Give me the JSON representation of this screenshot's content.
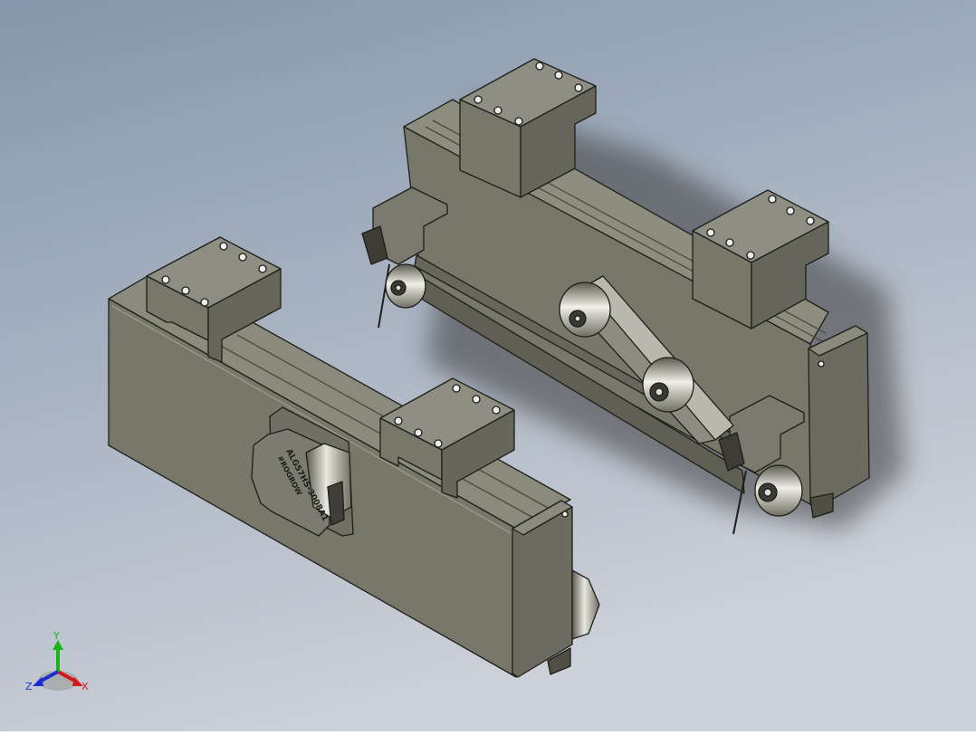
{
  "viewport": {
    "background_top": "#8a9bb0",
    "background_bottom": "#c9cdd6",
    "part_face_color": "#77776a",
    "part_top_color": "#8d8d80",
    "part_dark_color": "#55554b",
    "edge_color": "#1e1e1a"
  },
  "front_module": {
    "motor_label_line1": "ALG57HS-3008A1",
    "motor_label_line2": "#ROGROW"
  },
  "triad": {
    "x_label": "X",
    "y_label": "Y",
    "z_label": "Z",
    "x_color": "#d21a1a",
    "y_color": "#19b31a",
    "z_color": "#1a2fd2"
  }
}
